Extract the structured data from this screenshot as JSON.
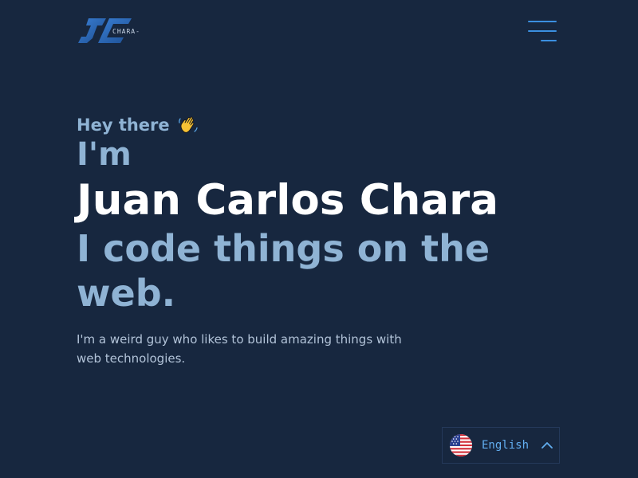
{
  "header": {
    "logo_text": "CHARA-",
    "logo_icon": "jc-logo-icon",
    "menu_icon": "hamburger-menu-icon",
    "accent_color": "#3b8fe0"
  },
  "hero": {
    "greeting": "Hey there",
    "greeting_icon": "waving-hand-icon",
    "intro": "I'm",
    "name": "Juan Carlos Chara",
    "tagline": "I code things on the web.",
    "description": "I'm a weird guy who likes to build amazing things with web technologies."
  },
  "language": {
    "selected": "English",
    "flag_icon": "us-flag-icon",
    "chevron_icon": "chevron-up-icon"
  },
  "colors": {
    "background": "#17273f",
    "heading_muted": "#8fb3d4",
    "heading_strong": "#ffffff",
    "body_text": "#b2c3d8",
    "link_blue": "#62aef0"
  }
}
